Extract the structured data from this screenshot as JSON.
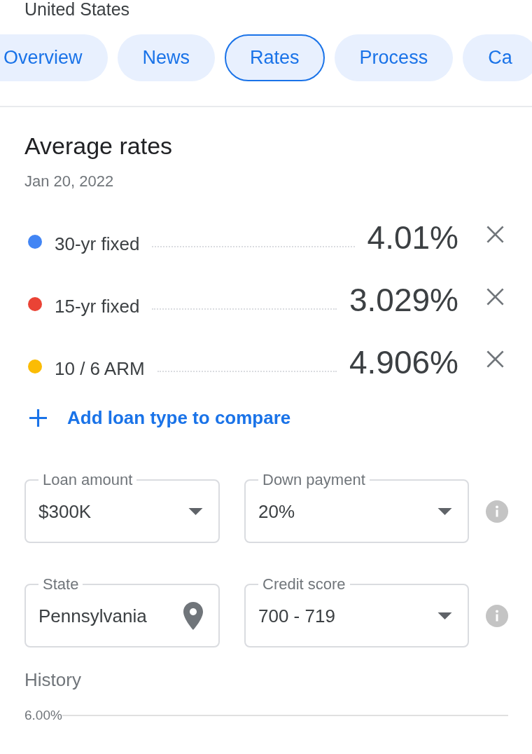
{
  "location": "United States",
  "tabs": [
    {
      "label": "Overview",
      "selected": false
    },
    {
      "label": "News",
      "selected": false
    },
    {
      "label": "Rates",
      "selected": true
    },
    {
      "label": "Process",
      "selected": false
    },
    {
      "label": "Ca",
      "selected": false
    }
  ],
  "rates": {
    "title": "Average rates",
    "date": "Jan 20, 2022",
    "loans": [
      {
        "name": "30-yr fixed",
        "rate": "4.01%",
        "color": "#4285f4"
      },
      {
        "name": "15-yr fixed",
        "rate": "3.029%",
        "color": "#ea4335"
      },
      {
        "name": "10 / 6 ARM",
        "rate": "4.906%",
        "color": "#fbbc04"
      }
    ],
    "add_action": "Add loan type to compare"
  },
  "filter_rows": [
    {
      "fields": [
        {
          "label": "Loan amount",
          "value": "$300K",
          "kind": "dropdown"
        },
        {
          "label": "Down payment",
          "value": "20%",
          "kind": "dropdown"
        }
      ],
      "info": true
    },
    {
      "fields": [
        {
          "label": "State",
          "value": "Pennsylvania",
          "kind": "location"
        },
        {
          "label": "Credit score",
          "value": "700 - 719",
          "kind": "dropdown"
        }
      ],
      "info": true
    }
  ],
  "history": {
    "title": "History",
    "axis_label": "6.00%"
  }
}
